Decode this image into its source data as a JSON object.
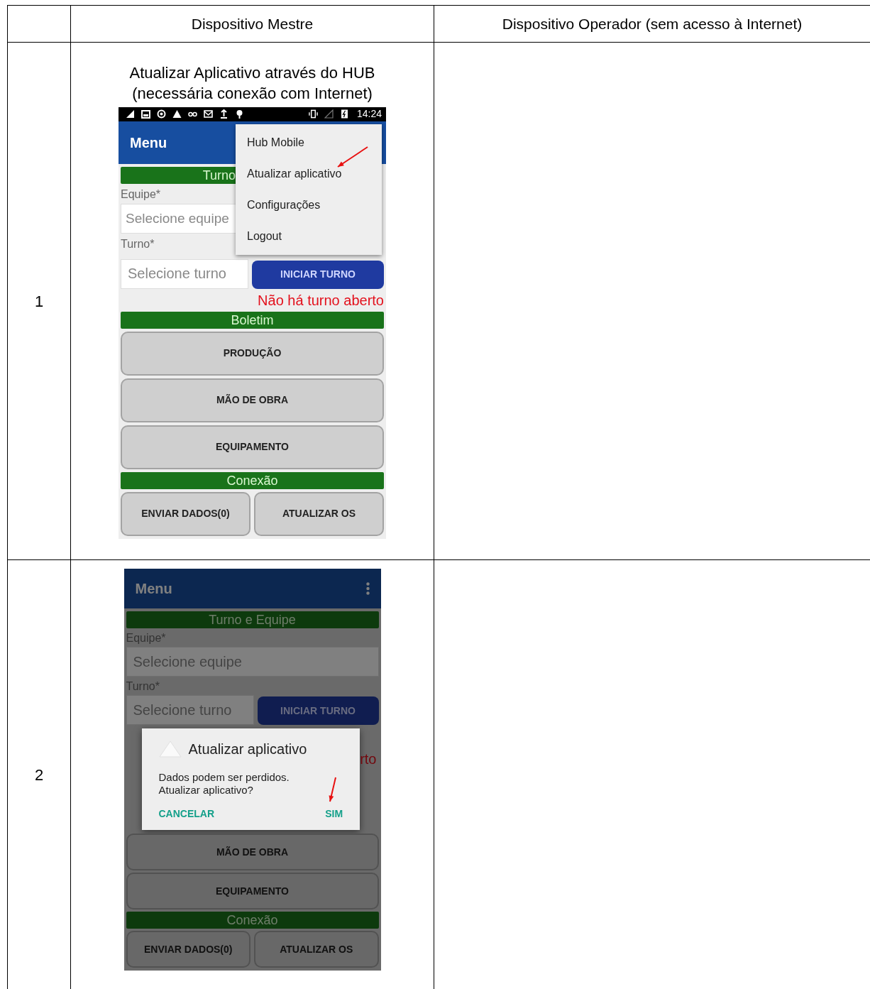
{
  "column_headers": [
    "Dispositivo Mestre",
    "Dispositivo Operador (sem acesso à Internet)"
  ],
  "rows": [
    {
      "step": "1",
      "caption": "Atualizar Aplicativo através do HUB\n(necessária conexão com Internet)",
      "screen": {
        "dimmed": false,
        "status_time": "14:24",
        "app_title": "Menu",
        "show_kebab": false,
        "items": [
          {
            "kind": "section",
            "text": "Turno",
            "partial": true
          },
          {
            "kind": "label",
            "text": "Equipe*"
          },
          {
            "kind": "field",
            "placeholder": "Selecione equipe",
            "partial": true
          },
          {
            "kind": "label",
            "text": "Turno*"
          },
          {
            "kind": "field_button",
            "placeholder": "Selecione turno",
            "button": "INICIAR TURNO"
          },
          {
            "kind": "notice",
            "text": "Não há turno aberto"
          },
          {
            "kind": "section",
            "text": "Boletim",
            "partial": false
          },
          {
            "kind": "button",
            "text": "PRODUÇÃO"
          },
          {
            "kind": "button",
            "text": "MÃO DE OBRA"
          },
          {
            "kind": "button",
            "text": "EQUIPAMENTO"
          },
          {
            "kind": "section",
            "text": "Conexão",
            "partial": false
          },
          {
            "kind": "button_pair",
            "buttons": [
              "ENVIAR DADOS(0)",
              "ATUALIZAR OS"
            ]
          }
        ],
        "menu": {
          "items": [
            "Hub Mobile",
            "Atualizar aplicativo",
            "Configurações",
            "Logout"
          ]
        }
      }
    },
    {
      "step": "2",
      "screen": {
        "dimmed": true,
        "app_title": "Menu",
        "show_kebab": true,
        "items": [
          {
            "kind": "section",
            "text": "Turno e Equipe",
            "partial": false
          },
          {
            "kind": "label",
            "text": "Equipe*"
          },
          {
            "kind": "field",
            "placeholder": "Selecione equipe",
            "partial": false
          },
          {
            "kind": "label",
            "text": "Turno*"
          },
          {
            "kind": "field_button",
            "placeholder": "Selecione turno",
            "button": "INICIAR TURNO"
          },
          {
            "kind": "dialog",
            "title": "Atualizar aplicativo",
            "message": "Dados podem ser perdidos.\nAtualizar aplicativo?",
            "negative": "CANCELAR",
            "positive": "SIM",
            "behind_text": "rto"
          },
          {
            "kind": "button",
            "text": "MÃO DE OBRA"
          },
          {
            "kind": "button",
            "text": "EQUIPAMENTO"
          },
          {
            "kind": "section",
            "text": "Conexão",
            "partial": false
          },
          {
            "kind": "button_pair",
            "buttons": [
              "ENVIAR DADOS(0)",
              "ATUALIZAR OS"
            ]
          }
        ]
      }
    }
  ]
}
